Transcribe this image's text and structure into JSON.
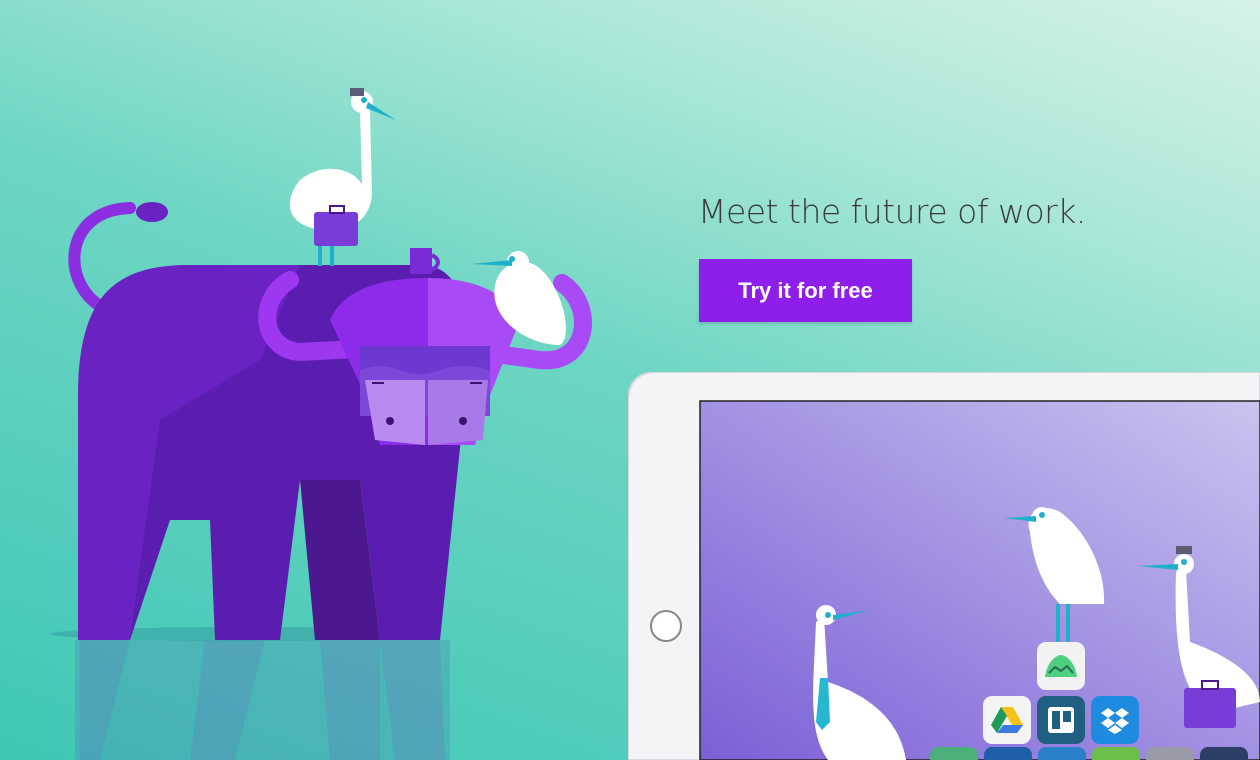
{
  "hero": {
    "headline": "Meet the future of work.",
    "cta_label": "Try it for free"
  },
  "colors": {
    "accent": "#8e1eea",
    "buffalo_dark": "#5b1cb0",
    "buffalo_mid": "#7a2bd6",
    "background_teal": "#3fc7b4",
    "tablet_screen": "#9a86dc"
  },
  "illustration": {
    "subject": "purple-buffalo-with-egrets",
    "tablet_apps": [
      {
        "name": "basecamp-app-icon"
      },
      {
        "name": "google-drive-app-icon"
      },
      {
        "name": "trello-app-icon"
      },
      {
        "name": "dropbox-app-icon"
      }
    ]
  }
}
